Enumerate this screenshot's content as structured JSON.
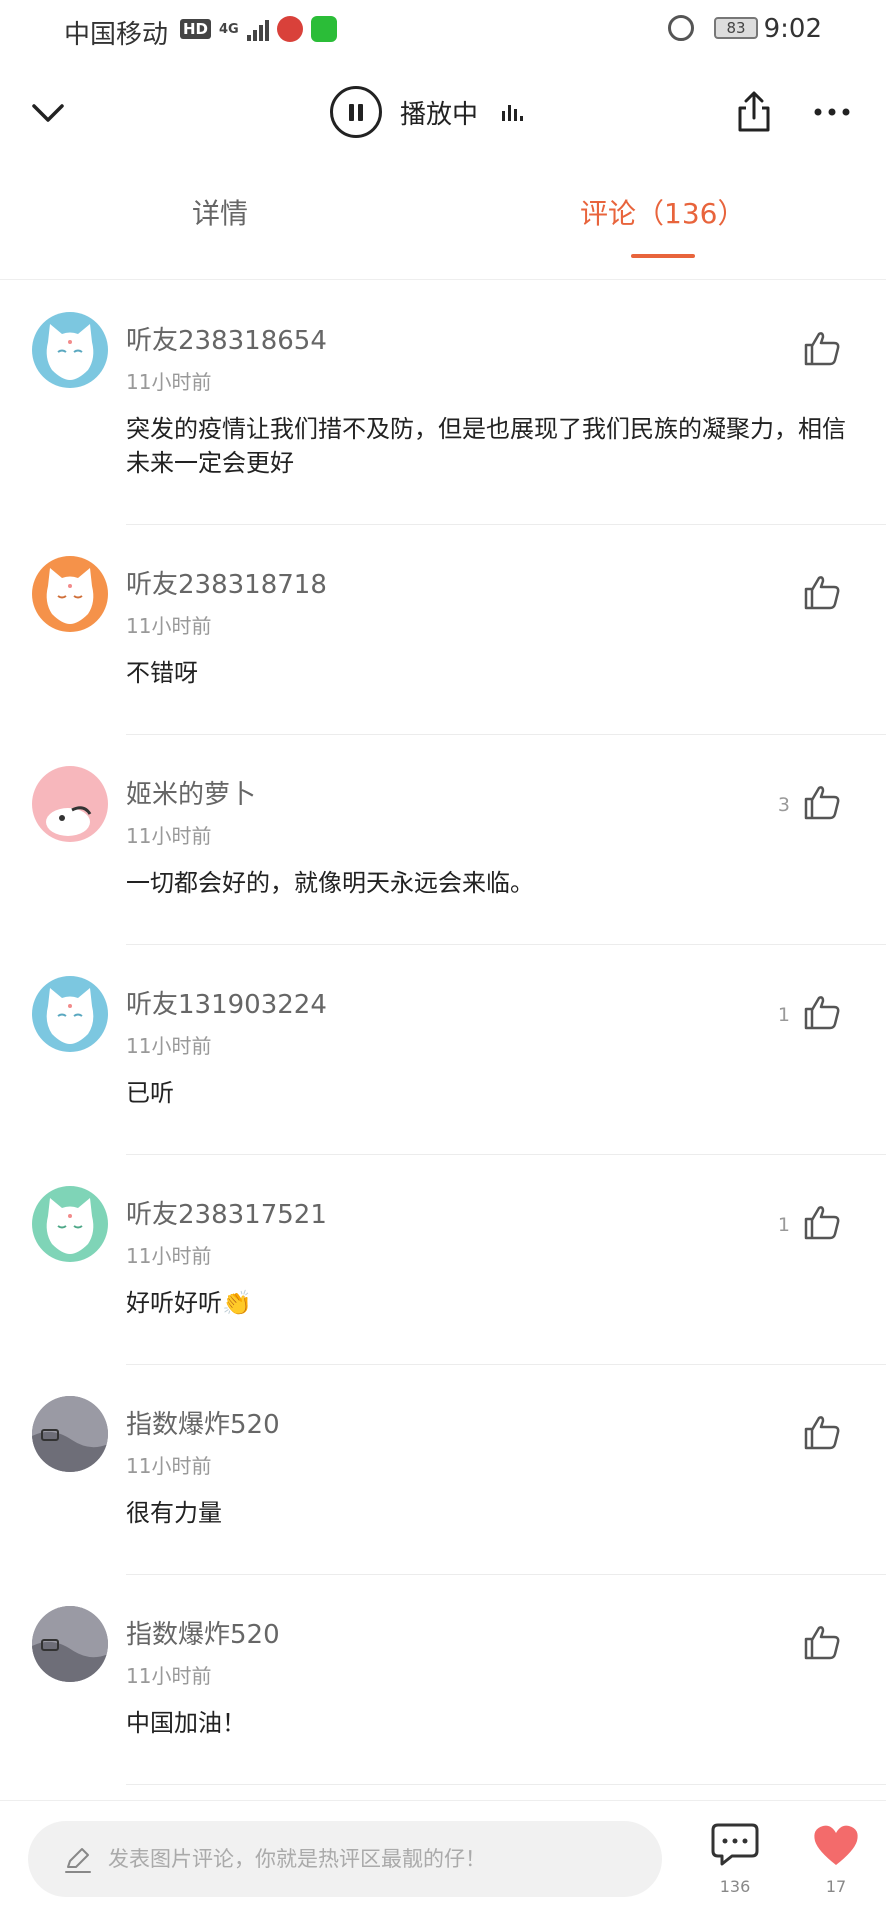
{
  "status_bar": {
    "carrier": "中国移动",
    "hd": "HD",
    "network": "4G",
    "battery": "83",
    "time": "9:02"
  },
  "top_bar": {
    "playing_label": "播放中"
  },
  "tabs": {
    "details_label": "详情",
    "comments_label": "评论（136）"
  },
  "comments": [
    {
      "username": "听友238318654",
      "time": "11小时前",
      "text": "突发的疫情让我们措不及防，但是也展现了我们民族的凝聚力，相信未来一定会更好",
      "likes": "",
      "avatar_color": "#7cc7e0"
    },
    {
      "username": "听友238318718",
      "time": "11小时前",
      "text": "不错呀",
      "likes": "",
      "avatar_color": "#f5924a"
    },
    {
      "username": "姬米的萝卜",
      "time": "11小时前",
      "text": "一切都会好的，就像明天永远会来临。",
      "likes": "3",
      "avatar_color": "#f7b7bc"
    },
    {
      "username": "听友131903224",
      "time": "11小时前",
      "text": "已听",
      "likes": "1",
      "avatar_color": "#7cc7e0"
    },
    {
      "username": "听友238317521",
      "time": "11小时前",
      "text": "好听好听👏",
      "likes": "1",
      "avatar_color": "#7fd4b7"
    },
    {
      "username": "指数爆炸520",
      "time": "11小时前",
      "text": "很有力量",
      "likes": "",
      "avatar_color": "#8a8a94"
    },
    {
      "username": "指数爆炸520",
      "time": "11小时前",
      "text": "中国加油！",
      "likes": "",
      "avatar_color": "#8a8a94"
    }
  ],
  "bottom_bar": {
    "input_placeholder": "发表图片评论，你就是热评区最靓的仔！",
    "comment_count": "136",
    "like_count": "17"
  },
  "colors": {
    "accent": "#e8643c",
    "heart": "#f36b6b"
  }
}
